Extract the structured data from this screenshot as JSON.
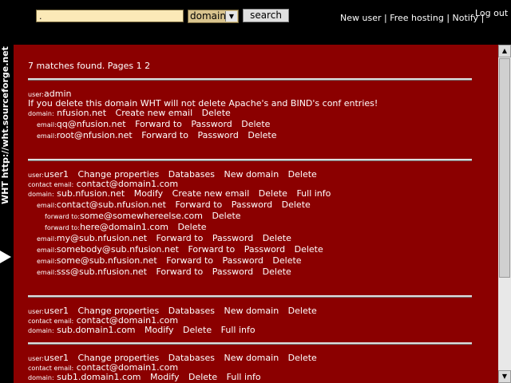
{
  "search": {
    "value": ".",
    "domain_option": "domain",
    "button": "search"
  },
  "topnav": {
    "new_user": "New user",
    "free_hosting": "Free hosting",
    "notify": "Notify",
    "sep": "|",
    "logout": "Log out"
  },
  "side": {
    "text": "WHT  http://wht.sourceforge.net"
  },
  "results": {
    "summary": "7 matches found. Pages 1 2"
  },
  "labels": {
    "user": "user:",
    "domain": "domain:",
    "email": "email:",
    "contact_email": "contact email:",
    "forward_to": "forward to:"
  },
  "actions": {
    "create_email": "Create new email",
    "delete": "Delete",
    "forward": "Forward to",
    "password": "Password",
    "change_props": "Change properties",
    "databases": "Databases",
    "new_domain": "New domain",
    "modify": "Modify",
    "full_info": "Full info"
  },
  "block1": {
    "user": "admin",
    "warning": "If you delete this domain WHT will not delete Apache's and BIND's conf entries!",
    "domain": "nfusion.net",
    "emails": [
      "qq@nfusion.net",
      "root@nfusion.net"
    ]
  },
  "block2": {
    "user": "user1",
    "contact": "contact@domain1.com",
    "domain": "sub.nfusion.net",
    "email1": "contact@sub.nfusion.net",
    "forwards": [
      "some@somewhereelse.com",
      "here@domain1.com"
    ],
    "emails": [
      "my@sub.nfusion.net",
      "somebody@sub.nfusion.net",
      "some@sub.nfusion.net",
      "sss@sub.nfusion.net"
    ]
  },
  "block3": {
    "user": "user1",
    "contact": "contact@domain1.com",
    "domain": "sub.domain1.com"
  },
  "block4": {
    "user": "user1",
    "contact": "contact@domain1.com",
    "domain": "sub1.domain1.com"
  }
}
